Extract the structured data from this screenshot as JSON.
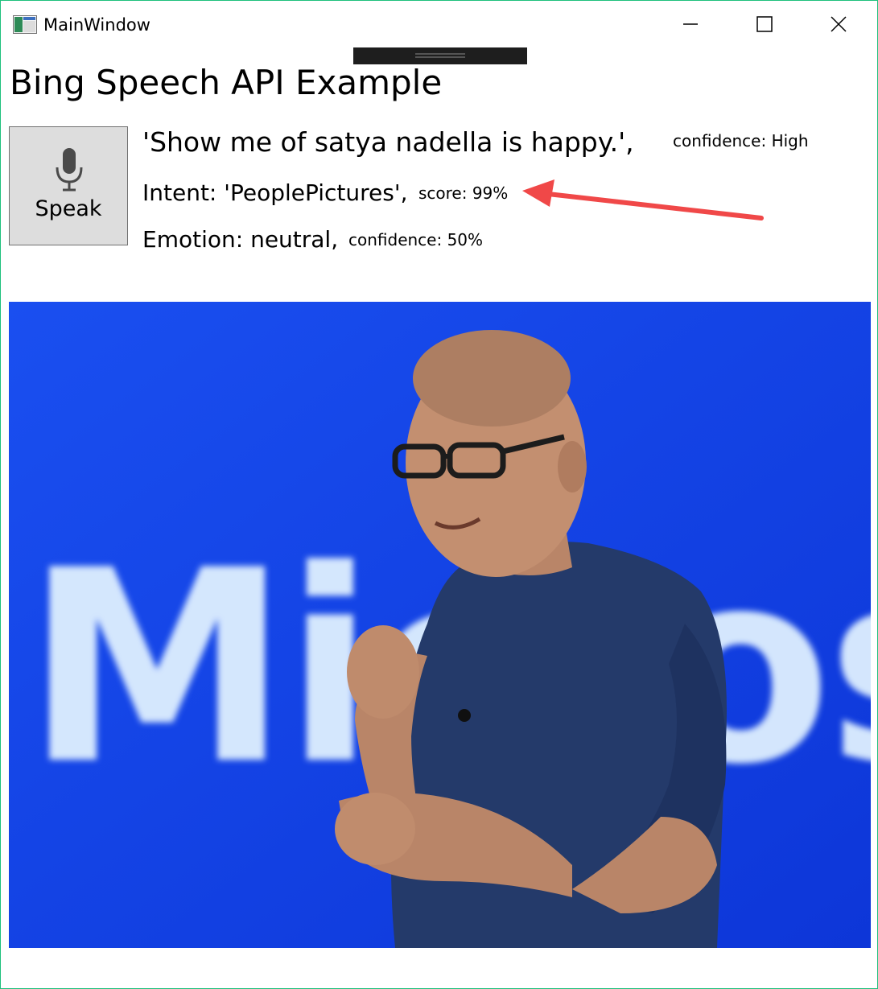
{
  "window": {
    "title": "MainWindow",
    "controls": [
      "minimize",
      "maximize",
      "close"
    ]
  },
  "page": {
    "title": "Bing Speech API Example"
  },
  "speak_button": {
    "label": "Speak",
    "icon": "microphone-icon"
  },
  "results": {
    "utterance": "'Show me of satya nadella is happy.',",
    "utterance_confidence": "confidence: High",
    "intent": "Intent: 'PeoplePictures',",
    "intent_score": "score: 99%",
    "emotion": "Emotion: neutral,",
    "emotion_confidence": "confidence: 50%"
  },
  "annotation": {
    "arrow_color": "#f04848"
  },
  "image": {
    "background_text": "Micros",
    "background_color": "#1240e4"
  }
}
